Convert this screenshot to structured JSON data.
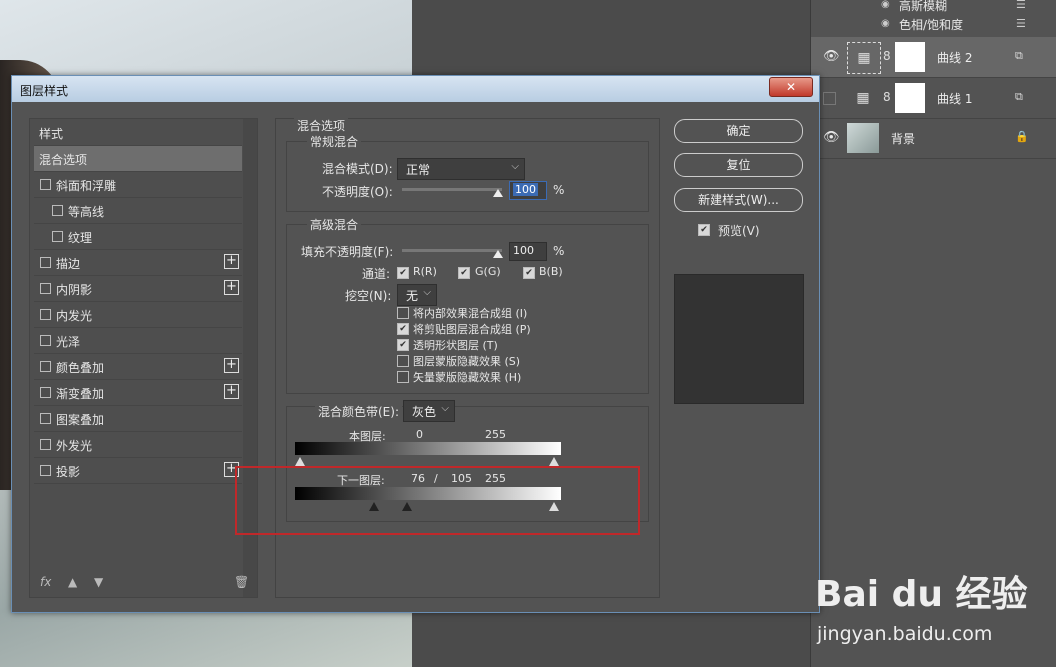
{
  "layers_panel": {
    "effects": [
      {
        "name": "高斯模糊"
      },
      {
        "name": "色相/饱和度"
      }
    ],
    "layers": [
      {
        "name": "曲线 2",
        "selected": true
      },
      {
        "name": "曲线 1",
        "selected": false
      },
      {
        "name": "背景",
        "selected": false
      }
    ]
  },
  "dialog": {
    "title": "图层样式",
    "close_label": "✕",
    "style_list": {
      "header": "样式",
      "items": [
        {
          "label": "混合选项",
          "active": true,
          "checkbox": false,
          "plus": false
        },
        {
          "label": "斜面和浮雕",
          "checkbox": true,
          "plus": false
        },
        {
          "label": "等高线",
          "checkbox": true,
          "plus": false,
          "indent": true
        },
        {
          "label": "纹理",
          "checkbox": true,
          "plus": false,
          "indent": true
        },
        {
          "label": "描边",
          "checkbox": true,
          "plus": true
        },
        {
          "label": "内阴影",
          "checkbox": true,
          "plus": true
        },
        {
          "label": "内发光",
          "checkbox": true,
          "plus": false
        },
        {
          "label": "光泽",
          "checkbox": true,
          "plus": false
        },
        {
          "label": "颜色叠加",
          "checkbox": true,
          "plus": true
        },
        {
          "label": "渐变叠加",
          "checkbox": true,
          "plus": true
        },
        {
          "label": "图案叠加",
          "checkbox": true,
          "plus": false
        },
        {
          "label": "外发光",
          "checkbox": true,
          "plus": false
        },
        {
          "label": "投影",
          "checkbox": true,
          "plus": true
        }
      ],
      "fx_label": "fx"
    },
    "blend_options": {
      "section_title": "混合选项",
      "general": {
        "title": "常规混合",
        "mode_label": "混合模式(D):",
        "mode_value": "正常",
        "opacity_label": "不透明度(O):",
        "opacity_value": "100",
        "percent": "%"
      },
      "advanced": {
        "title": "高级混合",
        "fill_label": "填充不透明度(F):",
        "fill_value": "100",
        "percent": "%",
        "channels_label": "通道:",
        "channel_r": "R(R)",
        "channel_g": "G(G)",
        "channel_b": "B(B)",
        "knockout_label": "挖空(N):",
        "knockout_value": "无",
        "options": [
          {
            "label": "将内部效果混合成组 (I)",
            "checked": false
          },
          {
            "label": "将剪贴图层混合成组 (P)",
            "checked": true
          },
          {
            "label": "透明形状图层 (T)",
            "checked": true
          },
          {
            "label": "图层蒙版隐藏效果 (S)",
            "checked": false
          },
          {
            "label": "矢量蒙版隐藏效果 (H)",
            "checked": false
          }
        ]
      },
      "blend_if": {
        "label": "混合颜色带(E):",
        "value": "灰色",
        "this_layer_label": "本图层:",
        "this_low": "0",
        "this_high": "255",
        "under_layer_label": "下一图层:",
        "under_low": "76",
        "under_sep": "/",
        "under_low2": "105",
        "under_high": "255"
      }
    },
    "buttons": {
      "ok": "确定",
      "reset": "复位",
      "new_style": "新建样式(W)...",
      "preview": "预览(V)"
    }
  },
  "watermark": {
    "logo": "Bai du 经验",
    "url": "jingyan.baidu.com"
  }
}
